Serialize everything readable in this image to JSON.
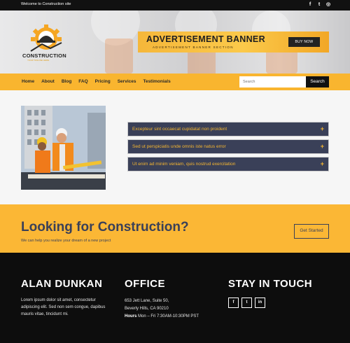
{
  "topbar": {
    "welcome": "Welcome to Construction site",
    "social": [
      {
        "icon": "facebook-icon",
        "glyph": "f"
      },
      {
        "icon": "twitter-icon",
        "glyph": "t"
      },
      {
        "icon": "instagram-icon",
        "glyph": "◎"
      }
    ]
  },
  "header": {
    "logo_name": "CONSTRUCTION",
    "logo_tagline": "YOUR TAGLINE HERE",
    "ad_title": "ADVERTISEMENT BANNER",
    "ad_subtitle": "ADVERTISEMENT BANNER SECTION",
    "ad_button": "BUY NOW"
  },
  "nav": {
    "items": [
      "Home",
      "About",
      "Blog",
      "FAQ",
      "Pricing",
      "Services",
      "Testimonials"
    ],
    "search_placeholder": "Search",
    "search_button": "Search"
  },
  "accordion": [
    {
      "label": "Excepteur sint occaecat cupidatat non proident",
      "icon": "plus-icon",
      "glyph": "+"
    },
    {
      "label": "Sed ut perspiciatis unde omnis iste natus error",
      "icon": "plus-icon",
      "glyph": "+"
    },
    {
      "label": "Ut enim ad minim veniam, quis nostrud exercitation",
      "icon": "plus-icon",
      "glyph": "+"
    }
  ],
  "cta": {
    "heading": "Looking for Construction?",
    "subtext": "We can help you realize your dream of a new project",
    "button": "Get Started"
  },
  "footer": {
    "col1_title": "ALAN DUNKAN",
    "col1_text": "Lorem ipsum dolor sit amet, consectetur adipiscing elit. Sed non sem congue, dapibus mauris vitae, tincidunt mi.",
    "col2_title": "OFFICE",
    "address_line1": "653 Jett Lane, Suite 50,",
    "address_line2": "Beverly Hills, CA 90210",
    "hours_label": "Hours",
    "hours_value": "Mon – Fri 7:30AM-10:30PM PST",
    "col3_title": "STAY IN TOUCH",
    "social": [
      {
        "icon": "facebook-icon",
        "glyph": "f"
      },
      {
        "icon": "twitter-icon",
        "glyph": "t"
      },
      {
        "icon": "linkedin-icon",
        "glyph": "in"
      }
    ]
  },
  "colors": {
    "accent": "#f9b52f",
    "navy": "#3a4058",
    "dark": "#0d0d0d"
  }
}
